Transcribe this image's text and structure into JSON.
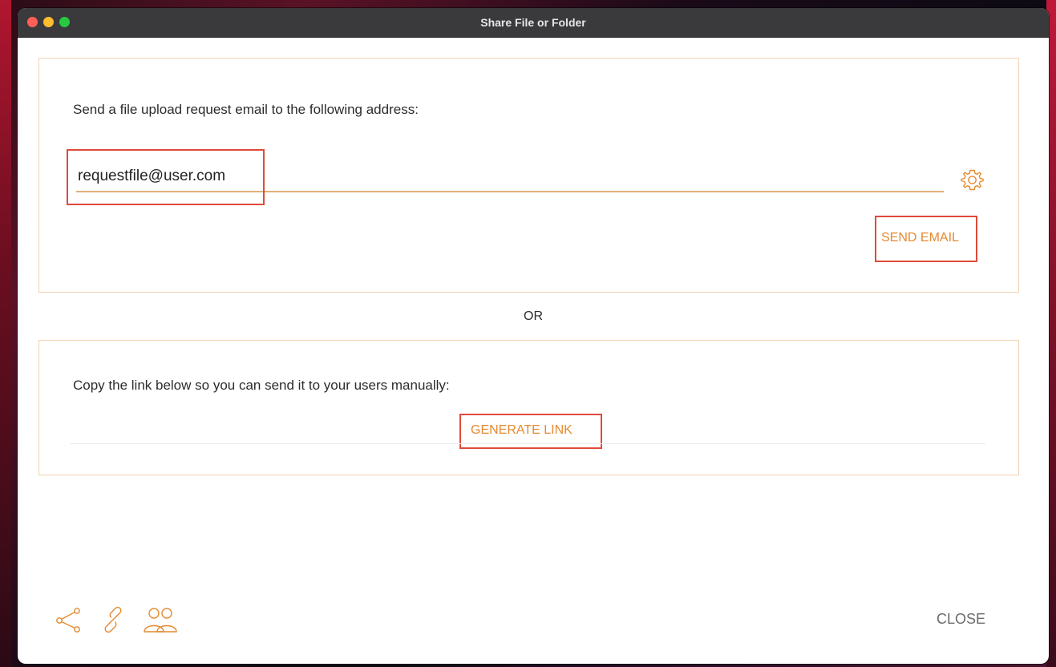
{
  "window": {
    "title": "Share File or Folder"
  },
  "email_section": {
    "prompt": "Send a file upload request email to the following address:",
    "email_value": "requestfile@user.com",
    "send_label": "SEND EMAIL",
    "settings_icon": "gear-icon"
  },
  "separator": {
    "label": "OR"
  },
  "link_section": {
    "prompt": "Copy the link below so you can send it to your users manually:",
    "generate_label": "GENERATE LINK"
  },
  "footer": {
    "icons": [
      "share-icon",
      "link-icon",
      "users-icon"
    ],
    "close_label": "CLOSE"
  },
  "colors": {
    "accent": "#e58a30",
    "highlight": "#e04a3a",
    "panel_border": "#f2d3b6",
    "titlebar": "#3a3a3c"
  }
}
